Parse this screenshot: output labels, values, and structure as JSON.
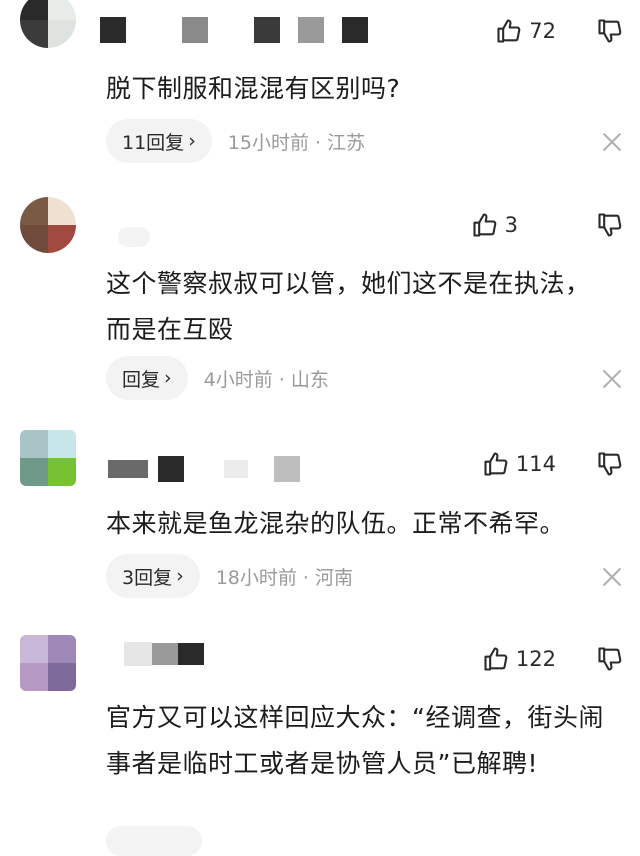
{
  "comments": [
    {
      "likes": "72",
      "text": "脱下制服和混混有区别吗?",
      "reply": "11回复",
      "time": "15小时前 · 江苏"
    },
    {
      "likes": "3",
      "text": "这个警察叔叔可以管，她们这不是在执法，而是在互殴",
      "reply": "回复",
      "time": "4小时前 · 山东"
    },
    {
      "likes": "114",
      "text": "本来就是鱼龙混杂的队伍。正常不希罕。",
      "reply": "3回复",
      "time": "18小时前 · 河南"
    },
    {
      "likes": "122",
      "text": "官方又可以这样回应大众：“经调查，街头闹事者是临时工或者是协管人员”已解聘!"
    }
  ],
  "icons": {
    "like": "thumbs-up-icon",
    "dislike": "thumbs-down-icon",
    "close": "close-icon",
    "chevron": "chevron-right-icon"
  }
}
